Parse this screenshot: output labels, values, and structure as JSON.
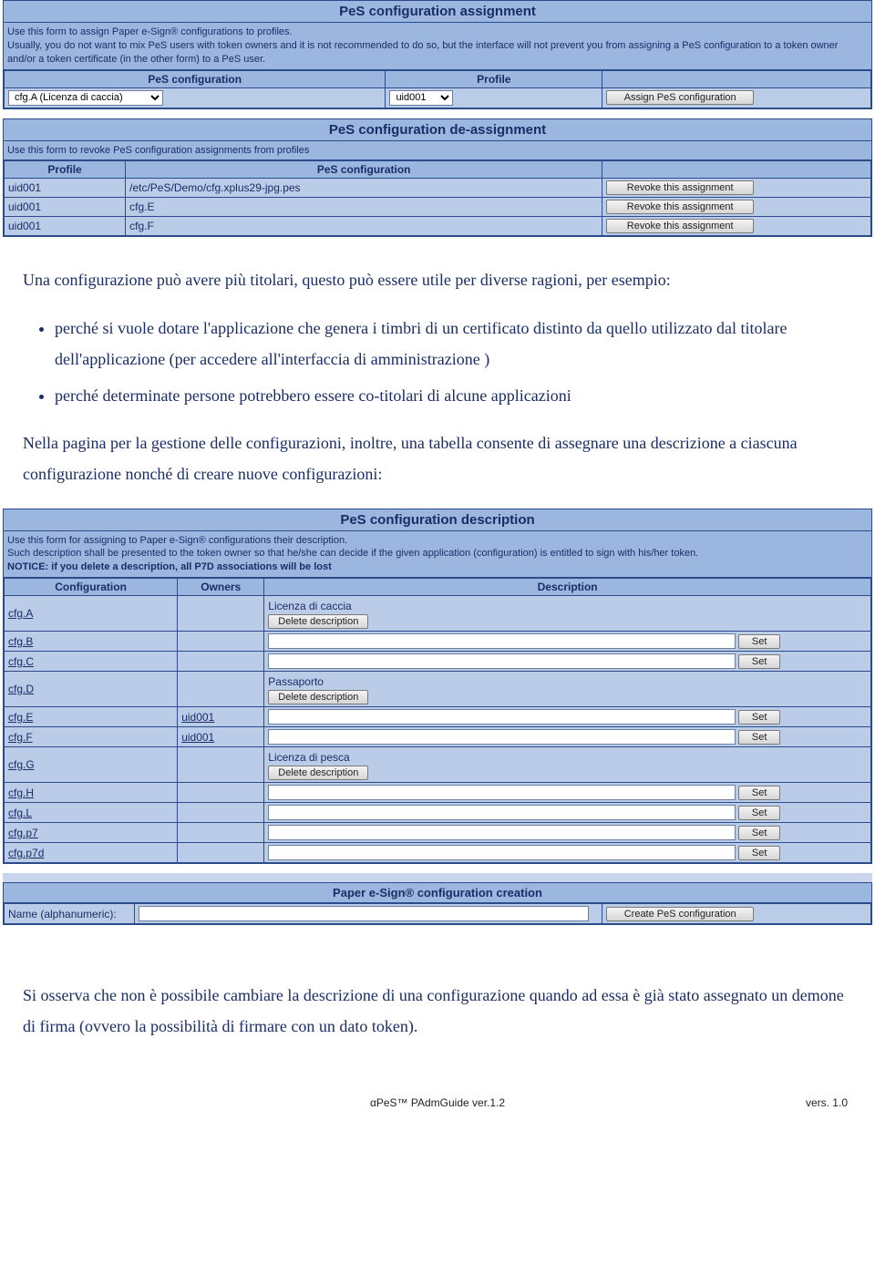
{
  "assign": {
    "title": "PeS configuration assignment",
    "intro": "Use this form to assign Paper e-Sign® configurations to profiles.\nUsually, you do not want to mix PeS users with token owners and it is not recommended to do so, but the interface will not prevent you from assigning a PeS configuration to a token owner and/or a token certificate (in the other form) to a PeS user.",
    "col_config": "PeS configuration",
    "col_profile": "Profile",
    "config_value": "cfg.A (Licenza di caccia)",
    "profile_value": "uid001",
    "button": "Assign PeS configuration"
  },
  "deassign": {
    "title": "PeS configuration de-assignment",
    "intro": "Use this form to revoke PeS configuration assignments from profiles",
    "col_profile": "Profile",
    "col_config": "PeS configuration",
    "rows": [
      {
        "profile": "uid001",
        "config": "/etc/PeS/Demo/cfg.xplus29-jpg.pes",
        "button": "Revoke this assignment"
      },
      {
        "profile": "uid001",
        "config": "cfg.E",
        "button": "Revoke this assignment"
      },
      {
        "profile": "uid001",
        "config": "cfg.F",
        "button": "Revoke this assignment"
      }
    ]
  },
  "prose1": {
    "p1": "Una configurazione può avere più titolari, questo può essere utile per diverse ragioni, per esempio:",
    "b1": "perché si vuole dotare l'applicazione che genera i timbri di un certificato distinto da quello utilizzato dal titolare dell'applicazione (per accedere all'interfaccia di amministrazione )",
    "b2": "perché determinate persone potrebbero essere co-titolari di alcune applicazioni",
    "p2": "Nella pagina per la gestione delle configurazioni, inoltre, una tabella consente di assegnare una descrizione a ciascuna configurazione nonché di creare nuove configurazioni:"
  },
  "desc": {
    "title": "PeS configuration description",
    "intro_l1": "Use this form for assigning to Paper e-Sign® configurations their description.",
    "intro_l2": "Such description shall be presented to the token owner so that he/she can decide if the given application (configuration) is entitled to sign with his/her token.",
    "intro_l3": "NOTICE: if you delete a description, all P7D associations will be lost",
    "col_config": "Configuration",
    "col_owners": "Owners",
    "col_desc": "Description",
    "delete_label": "Delete description",
    "set_label": "Set",
    "rows": [
      {
        "config": "cfg.A",
        "owners": "",
        "desc_value": "Licenza di caccia",
        "has_desc": true
      },
      {
        "config": "cfg.B",
        "owners": "",
        "has_desc": false
      },
      {
        "config": "cfg.C",
        "owners": "",
        "has_desc": false
      },
      {
        "config": "cfg.D",
        "owners": "",
        "desc_value": "Passaporto",
        "has_desc": true
      },
      {
        "config": "cfg.E",
        "owners": "uid001",
        "owner_link": true,
        "has_desc": false
      },
      {
        "config": "cfg.F",
        "owners": "uid001",
        "owner_link": true,
        "has_desc": false
      },
      {
        "config": "cfg.G",
        "owners": "",
        "desc_value": "Licenza di pesca",
        "has_desc": true
      },
      {
        "config": "cfg.H",
        "owners": "",
        "has_desc": false
      },
      {
        "config": "cfg.L",
        "owners": "",
        "has_desc": false
      },
      {
        "config": "cfg.p7",
        "owners": "",
        "has_desc": false
      },
      {
        "config": "cfg.p7d",
        "owners": "",
        "has_desc": false
      }
    ]
  },
  "create": {
    "title": "Paper e-Sign® configuration creation",
    "label": "Name (alphanumeric):",
    "button": "Create PeS configuration"
  },
  "prose2": "Si osserva che non è possibile cambiare la descrizione di una configurazione quando ad essa è già stato assegnato un demone di firma (ovvero la possibilità di firmare con un dato token).",
  "footer": {
    "center": "αPeS™ PAdmGuide ver.1.2",
    "right": "vers. 1.0"
  }
}
